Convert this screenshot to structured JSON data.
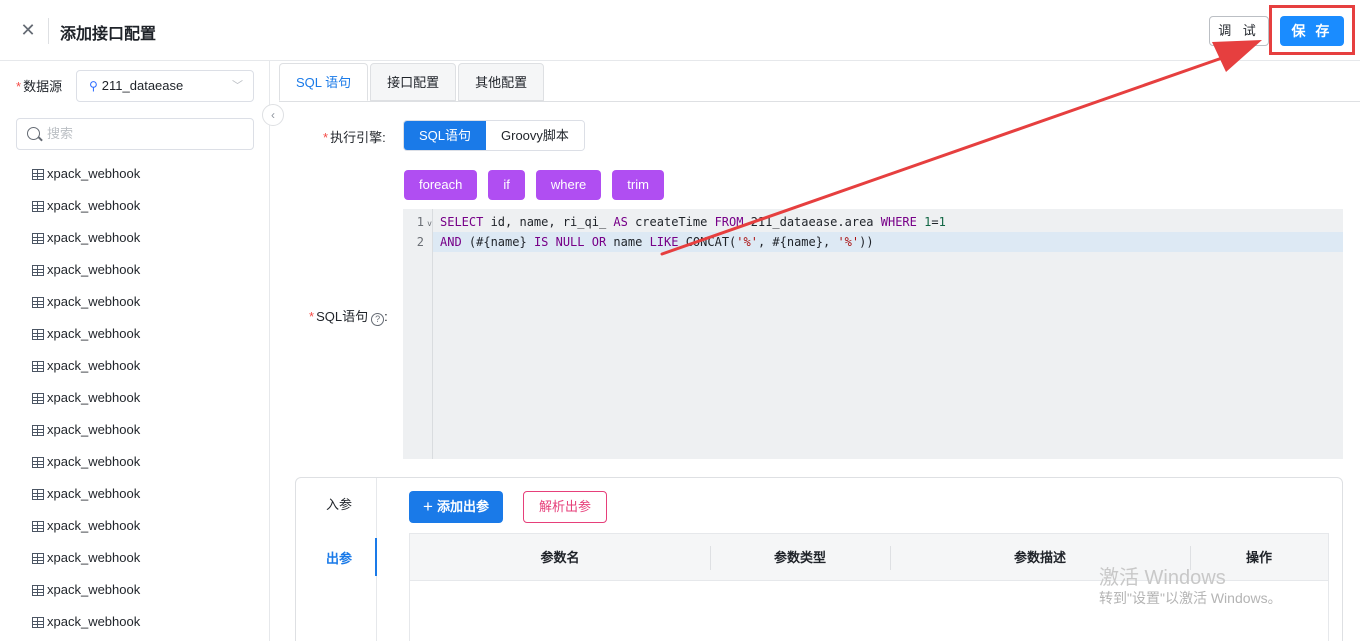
{
  "header": {
    "close_glyph": "✕",
    "title": "添加接口配置",
    "debug_label": "调 试",
    "save_label": "保 存"
  },
  "sidebar": {
    "datasource_required": "*",
    "datasource_label": "数据源",
    "datasource_value": "211_dataease",
    "search_placeholder": "搜索",
    "tables": [
      "xpack_webhook",
      "xpack_webhook",
      "xpack_webhook",
      "xpack_webhook",
      "xpack_webhook",
      "xpack_webhook",
      "xpack_webhook",
      "xpack_webhook",
      "xpack_webhook",
      "xpack_webhook",
      "xpack_webhook",
      "xpack_webhook",
      "xpack_webhook",
      "xpack_webhook",
      "xpack_webhook"
    ]
  },
  "tabs": [
    "SQL 语句",
    "接口配置",
    "其他配置"
  ],
  "form": {
    "required": "*",
    "engine_label": "执行引擎:",
    "engine_options": [
      "SQL语句",
      "Groovy脚本"
    ],
    "snippets": [
      "foreach",
      "if",
      "where",
      "trim"
    ],
    "sql_label": "SQL语句",
    "sql_colon": ":"
  },
  "editor": {
    "line_numbers": [
      "1",
      "2"
    ],
    "lines": [
      [
        {
          "t": "SELECT",
          "c": "kw"
        },
        {
          "t": " id, name, ri_qi_ "
        },
        {
          "t": "AS",
          "c": "kw"
        },
        {
          "t": " createTime "
        },
        {
          "t": "FROM",
          "c": "kw"
        },
        {
          "t": " 211_dataease.area "
        },
        {
          "t": "WHERE",
          "c": "kw"
        },
        {
          "t": " "
        },
        {
          "t": "1",
          "c": "num"
        },
        {
          "t": "="
        },
        {
          "t": "1",
          "c": "num"
        }
      ],
      [
        {
          "t": "AND",
          "c": "kw"
        },
        {
          "t": " (#{name} "
        },
        {
          "t": "IS NULL",
          "c": "kw"
        },
        {
          "t": " "
        },
        {
          "t": "OR",
          "c": "kw"
        },
        {
          "t": " name "
        },
        {
          "t": "LIKE",
          "c": "kw"
        },
        {
          "t": " CONCAT("
        },
        {
          "t": "'%'",
          "c": "str"
        },
        {
          "t": ", #{name}, "
        },
        {
          "t": "'%'",
          "c": "str"
        },
        {
          "t": "))"
        }
      ]
    ]
  },
  "params": {
    "tab_in": "入参",
    "tab_out": "出参",
    "add_label": "添加出参",
    "parse_label": "解析出参",
    "columns": [
      "参数名",
      "参数类型",
      "参数描述",
      "操作"
    ]
  },
  "watermark": {
    "line1": "激活 Windows",
    "line2": "转到\"设置\"以激活 Windows。"
  },
  "colors": {
    "primary": "#1a7ae8",
    "save_button": "#1a8cff",
    "snippet_chip": "#b04ef2",
    "annotation": "#e63f3f"
  }
}
